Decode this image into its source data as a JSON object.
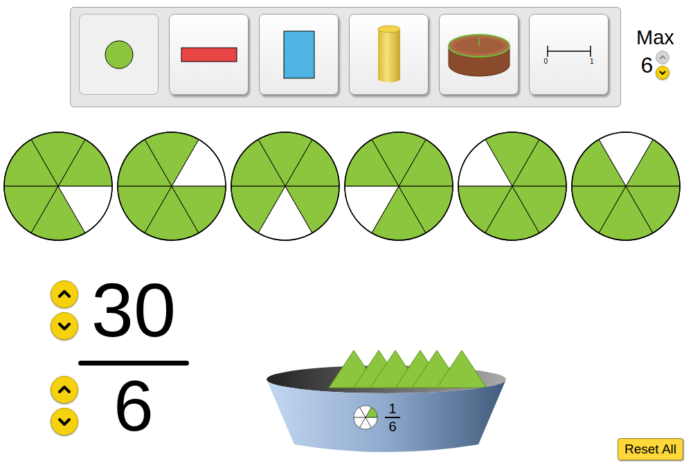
{
  "toolbar": {
    "representations": [
      {
        "kind": "circle",
        "selected": true
      },
      {
        "kind": "horizontal-bar",
        "selected": false
      },
      {
        "kind": "vertical-bar",
        "selected": false
      },
      {
        "kind": "water-glass",
        "selected": false
      },
      {
        "kind": "cake",
        "selected": false
      },
      {
        "kind": "number-line",
        "selected": false,
        "start": "0",
        "end": "1"
      }
    ],
    "max": {
      "label": "Max",
      "value": "6",
      "up_disabled": true,
      "down_disabled": false
    }
  },
  "pies": [
    {
      "slices": [
        true,
        true,
        true,
        true,
        true,
        false
      ]
    },
    {
      "slices": [
        false,
        true,
        true,
        true,
        true,
        true
      ]
    },
    {
      "slices": [
        true,
        true,
        true,
        true,
        false,
        true
      ]
    },
    {
      "slices": [
        true,
        true,
        true,
        false,
        true,
        true
      ]
    },
    {
      "slices": [
        true,
        true,
        false,
        true,
        true,
        true
      ]
    },
    {
      "slices": [
        true,
        false,
        true,
        true,
        true,
        true
      ]
    }
  ],
  "fraction": {
    "numerator": "30",
    "denominator": "6",
    "numerator_up_disabled": false,
    "numerator_down_disabled": false,
    "denominator_up_disabled": false,
    "denominator_down_disabled": false
  },
  "bucket": {
    "pieces": 6,
    "label_numerator": "1",
    "label_denominator": "6"
  },
  "reset_button": "Reset All"
}
